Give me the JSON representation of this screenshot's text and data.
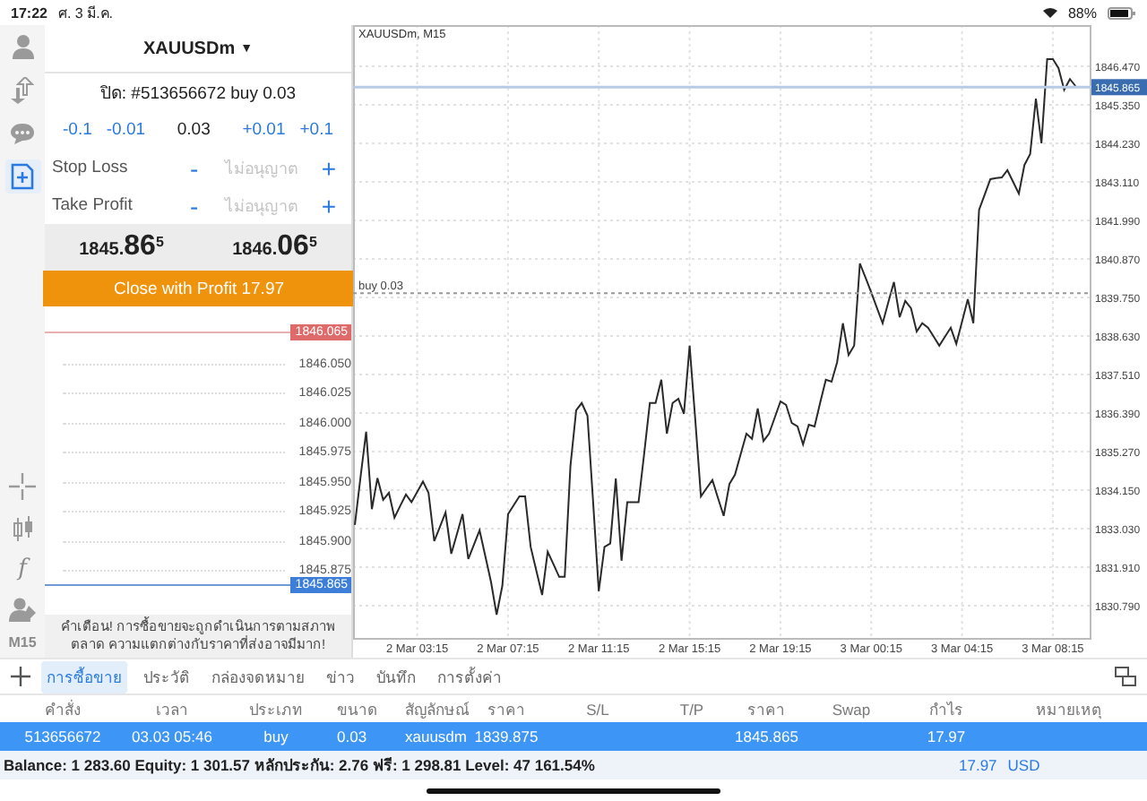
{
  "status_bar": {
    "time": "17:22",
    "date": "ศ. 3 มี.ค.",
    "battery": "88%"
  },
  "toolbar": {
    "top": [
      {
        "kind": "account",
        "selected": false
      },
      {
        "kind": "trade",
        "selected": false
      },
      {
        "kind": "chat",
        "selected": false
      },
      {
        "kind": "new-order",
        "selected": true
      }
    ],
    "bottom": [
      {
        "kind": "crosshair"
      },
      {
        "kind": "candles"
      },
      {
        "kind": "indicator",
        "label": "f"
      },
      {
        "kind": "objects"
      },
      {
        "kind": "timeframe",
        "label": "M15"
      }
    ]
  },
  "order": {
    "symbol": "XAUUSDm",
    "symbol_caret": "▼",
    "position": "ปิด: #513656672 buy 0.03",
    "volume_decrease": [
      "-0.1",
      "-0.01"
    ],
    "volume": "0.03",
    "volume_increase": [
      "+0.01",
      "+0.1"
    ],
    "stops": [
      {
        "label": "Stop Loss",
        "minus": "-",
        "placeholder": "ไม่อนุญาต",
        "plus": "+"
      },
      {
        "label": "Take Profit",
        "minus": "-",
        "placeholder": "ไม่อนุญาต",
        "plus": "+"
      }
    ],
    "bid": "1845.86$^{5}$",
    "ask": "1846.06$^{5}$",
    "close_button": "Close with Profit 17.97",
    "ladder": {
      "ask": "1846.065",
      "levels": [
        "1846.050",
        "1846.025",
        "1846.000",
        "1845.975",
        "1845.950",
        "1845.925",
        "1845.900",
        "1845.875"
      ],
      "bid": "1845.865"
    },
    "warning": "คำเตือน! การซื้อขายจะถูกดำเนินการตามสภาพตลาด ความแตกต่างกับราคาที่ส่งอาจมีมาก!"
  },
  "chart": {
    "chart_data": {
      "type": "line",
      "title": "XAUUSDm, M15",
      "categories": [
        null,
        null,
        null,
        null,
        null,
        null,
        null,
        null,
        null,
        null,
        null,
        "2 Mar 03:15",
        null,
        null,
        null,
        null,
        null,
        null,
        null,
        null,
        null,
        null,
        null,
        null,
        null,
        null,
        null,
        "2 Mar 07:15",
        null,
        null,
        null,
        null,
        null,
        null,
        null,
        null,
        null,
        null,
        null,
        null,
        null,
        null,
        null,
        "2 Mar 11:15",
        null,
        null,
        null,
        null,
        null,
        null,
        null,
        null,
        null,
        null,
        null,
        null,
        null,
        null,
        null,
        "2 Mar 15:15",
        null,
        null,
        null,
        null,
        null,
        null,
        null,
        null,
        null,
        null,
        null,
        null,
        null,
        null,
        null,
        "2 Mar 19:15",
        null,
        null,
        null,
        null,
        null,
        null,
        null,
        null,
        null,
        null,
        null,
        null,
        null,
        null,
        null,
        "3 Mar 00:15",
        null,
        null,
        null,
        null,
        null,
        null,
        null,
        null,
        null,
        null,
        null,
        null,
        null,
        null,
        null,
        "3 Mar 04:15",
        null,
        null,
        null,
        null,
        null,
        null,
        null,
        null,
        null,
        null,
        null,
        null,
        null,
        null,
        null,
        "3 Mar 08:15",
        null,
        null,
        null,
        null
      ],
      "series": [
        {
          "color": "#2a2a2a",
          "values": [
            1833.14,
            1834.5,
            1835.85,
            1833.6,
            1834.5,
            1833.87,
            1834.07,
            1833.35,
            1833.69,
            1834.02,
            1833.8,
            1834.1,
            1834.4,
            1834.07,
            1832.67,
            1833.09,
            1833.5,
            1832.3,
            1832.88,
            1833.45,
            1832.15,
            1832.57,
            1832.98,
            1832.23,
            1831.47,
            1830.53,
            1831.37,
            1833.45,
            1833.71,
            1833.97,
            1833.97,
            1832.5,
            1831.8,
            1831.1,
            1832.36,
            1832.0,
            1831.63,
            1831.63,
            1834.86,
            1836.47,
            1836.68,
            1836.31,
            1833.76,
            1831.21,
            1832.5,
            1832.6,
            1834.49,
            1832.1,
            1833.8,
            1833.8,
            1833.8,
            1835.24,
            1836.68,
            1836.68,
            1837.36,
            1835.79,
            1836.68,
            1836.8,
            1836.37,
            1838.35,
            1836.16,
            1833.97,
            1834.21,
            1834.44,
            1833.92,
            1833.4,
            1834.33,
            1834.6,
            1835.2,
            1835.79,
            1835.64,
            1836.52,
            1835.58,
            1835.79,
            1836.26,
            1836.73,
            1836.63,
            1836.1,
            1836.0,
            1835.48,
            1836.05,
            1836.0,
            1836.68,
            1837.36,
            1837.3,
            1837.87,
            1839.0,
            1838.08,
            1838.35,
            1840.74,
            1840.32,
            1839.9,
            1839.45,
            1839.0,
            1839.6,
            1840.2,
            1839.18,
            1839.65,
            1839.44,
            1838.76,
            1839.0,
            1838.87,
            1838.61,
            1838.35,
            1838.61,
            1838.87,
            1838.4,
            1839.05,
            1839.7,
            1839.0,
            1842.3,
            1842.75,
            1843.19,
            1843.22,
            1843.24,
            1843.45,
            1843.11,
            1842.77,
            1843.6,
            1843.92,
            1845.53,
            1844.23,
            1846.68,
            1846.68,
            1846.42,
            1845.79,
            1846.1,
            1845.9
          ]
        }
      ],
      "ylim": [
        1829.8,
        1847.67
      ],
      "grid": true,
      "ref_lines": [
        {
          "axis": "y",
          "value": 1845.865,
          "label": "1845.865",
          "color": "#b7cbe6"
        },
        {
          "axis": "y",
          "value": 1839.875,
          "label": "buy 0.03",
          "color": "#999999"
        }
      ],
      "yticks": [
        {
          "value": 1846.47,
          "label": "1846.470"
        },
        {
          "value": 1845.35,
          "label": "1845.350"
        },
        {
          "value": 1844.23,
          "label": "1844.230"
        },
        {
          "value": 1843.11,
          "label": "1843.110"
        },
        {
          "value": 1841.99,
          "label": "1841.990"
        },
        {
          "value": 1840.87,
          "label": "1840.870"
        },
        {
          "value": 1839.75,
          "label": "1839.750"
        },
        {
          "value": 1838.63,
          "label": "1838.630"
        },
        {
          "value": 1837.51,
          "label": "1837.510"
        },
        {
          "value": 1836.39,
          "label": "1836.390"
        },
        {
          "value": 1835.27,
          "label": "1835.270"
        },
        {
          "value": 1834.15,
          "label": "1834.150"
        },
        {
          "value": 1833.03,
          "label": "1833.030"
        },
        {
          "value": 1831.91,
          "label": "1831.910"
        },
        {
          "value": 1830.79,
          "label": "1830.790"
        }
      ]
    }
  },
  "tabs": [
    {
      "label": "การซื้อขาย",
      "selected": true
    },
    {
      "label": "ประวัติ",
      "selected": false
    },
    {
      "label": "กล่องจดหมาย",
      "selected": false
    },
    {
      "label": "ข่าว",
      "selected": false
    },
    {
      "label": "บันทึก",
      "selected": false
    },
    {
      "label": "การตั้งค่า",
      "selected": false
    }
  ],
  "table": {
    "columns": [
      "คำสั่ง",
      "เวลา",
      "ประเภท",
      "ขนาด",
      "สัญลักษณ์",
      "ราคา",
      "S/L",
      "T/P",
      "ราคา",
      "Swap",
      "กำไร",
      "หมายเหตุ"
    ],
    "rows": [
      {
        "order": "513656672",
        "time": "03.03 05:46",
        "type": "buy",
        "volume": "0.03",
        "symbol": "xauusdm",
        "open_price": "1839.875",
        "price": "1845.865",
        "profit": "17.97",
        "selected": true
      }
    ]
  },
  "footer": {
    "summary": "Balance: 1 283.60 Equity: 1 301.57 หลักประกัน: 2.76 ฟรี: 1 298.81 Level: 47 161.54%",
    "profit": "17.97",
    "currency": "USD"
  }
}
